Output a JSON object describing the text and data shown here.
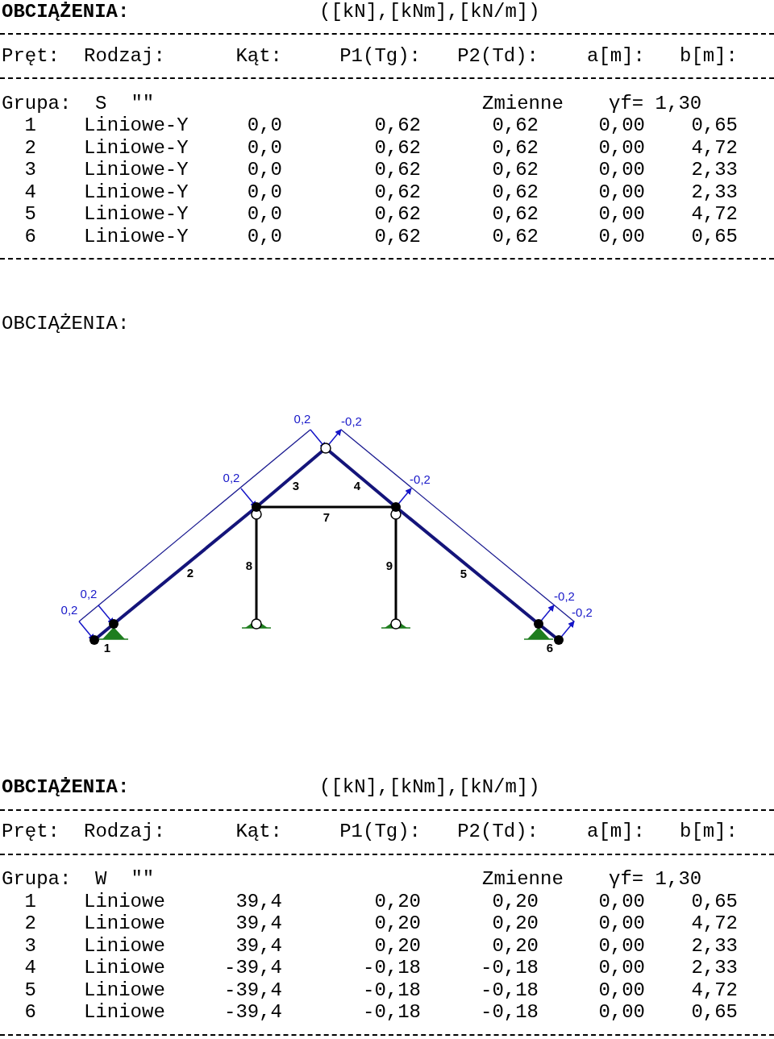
{
  "sections": [
    {
      "kind": "table",
      "title": "OBCIĄŻENIA:",
      "units": "([kN],[kNm],[kN/m])",
      "columns": [
        "Pręt:",
        "Rodzaj:",
        "Kąt:",
        "P1(Tg):",
        "P2(Td):",
        "a[m]:",
        "b[m]:"
      ],
      "group": {
        "label": "Grupa:",
        "name": "S",
        "quote": "\"\"",
        "type": "Zmienne",
        "factor": "γf= 1,30"
      },
      "rows": [
        [
          "1",
          "Liniowe-Y",
          "0,0",
          "0,62",
          "0,62",
          "0,00",
          "0,65"
        ],
        [
          "2",
          "Liniowe-Y",
          "0,0",
          "0,62",
          "0,62",
          "0,00",
          "4,72"
        ],
        [
          "3",
          "Liniowe-Y",
          "0,0",
          "0,62",
          "0,62",
          "0,00",
          "2,33"
        ],
        [
          "4",
          "Liniowe-Y",
          "0,0",
          "0,62",
          "0,62",
          "0,00",
          "2,33"
        ],
        [
          "5",
          "Liniowe-Y",
          "0,0",
          "0,62",
          "0,62",
          "0,00",
          "4,72"
        ],
        [
          "6",
          "Liniowe-Y",
          "0,0",
          "0,62",
          "0,62",
          "0,00",
          "0,65"
        ]
      ]
    },
    {
      "kind": "diagram",
      "title": "OBCIĄŻENIA:",
      "member_labels": [
        "1",
        "2",
        "3",
        "4",
        "5",
        "6",
        "7",
        "8",
        "9"
      ],
      "load_labels": [
        "0,2",
        "0,2",
        "0,2",
        "0,2",
        "-0,2",
        "-0,2",
        "-0,2",
        "-0,2"
      ]
    },
    {
      "kind": "table",
      "title": "OBCIĄŻENIA:",
      "units": "([kN],[kNm],[kN/m])",
      "columns": [
        "Pręt:",
        "Rodzaj:",
        "Kąt:",
        "P1(Tg):",
        "P2(Td):",
        "a[m]:",
        "b[m]:"
      ],
      "group": {
        "label": "Grupa:",
        "name": "W",
        "quote": "\"\"",
        "type": "Zmienne",
        "factor": "γf= 1,30"
      },
      "rows": [
        [
          "1",
          "Liniowe",
          "39,4",
          "0,20",
          "0,20",
          "0,00",
          "0,65"
        ],
        [
          "2",
          "Liniowe",
          "39,4",
          "0,20",
          "0,20",
          "0,00",
          "4,72"
        ],
        [
          "3",
          "Liniowe",
          "39,4",
          "0,20",
          "0,20",
          "0,00",
          "2,33"
        ],
        [
          "4",
          "Liniowe",
          "-39,4",
          "-0,18",
          "-0,18",
          "0,00",
          "2,33"
        ],
        [
          "5",
          "Liniowe",
          "-39,4",
          "-0,18",
          "-0,18",
          "0,00",
          "4,72"
        ],
        [
          "6",
          "Liniowe",
          "-39,4",
          "-0,18",
          "-0,18",
          "0,00",
          "0,65"
        ]
      ]
    }
  ]
}
